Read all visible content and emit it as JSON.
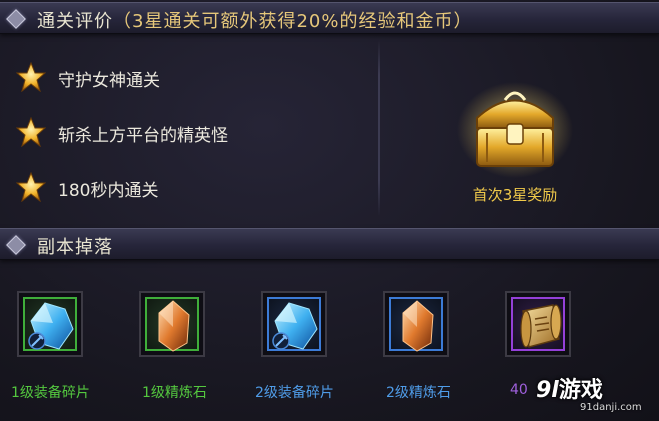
{
  "evaluation": {
    "title": "通关评价",
    "note": "（3星通关可额外获得20%的经验和金币）",
    "goals": [
      {
        "label": "守护女神通关"
      },
      {
        "label": "斩杀上方平台的精英怪"
      },
      {
        "label": "180秒内通关"
      }
    ],
    "reward_caption": "首次3星奖励"
  },
  "drops": {
    "title": "副本掉落",
    "items": [
      {
        "name": "1级装备碎片",
        "icon": "blue-crystal-icon",
        "rarity": "green"
      },
      {
        "name": "1级精炼石",
        "icon": "orange-crystal-icon",
        "rarity": "green"
      },
      {
        "name": "2级装备碎片",
        "icon": "blue-crystal-icon",
        "rarity": "blue"
      },
      {
        "name": "2级精炼石",
        "icon": "orange-crystal-icon",
        "rarity": "blue"
      },
      {
        "name": "40",
        "icon": "scroll-icon",
        "rarity": "purple"
      }
    ]
  },
  "watermark": {
    "logo_number": "9l",
    "logo_text": "游戏",
    "url": "91danji.com"
  },
  "colors": {
    "gold": "#f0c94a",
    "rarity_green": "#3fae3a",
    "rarity_blue": "#3c7bd6",
    "rarity_purple": "#9440d8"
  }
}
